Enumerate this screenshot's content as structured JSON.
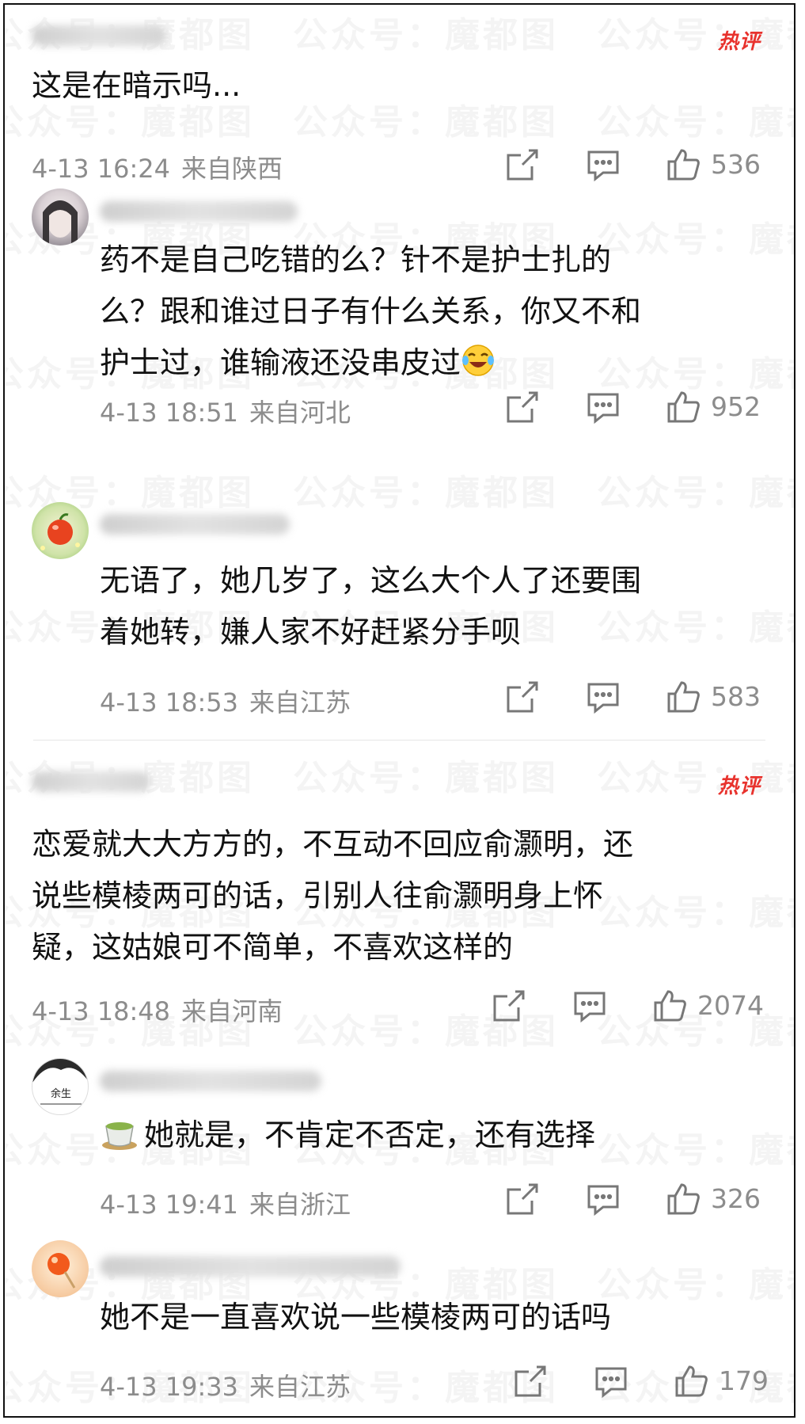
{
  "watermark_text": "公众号：魔都图",
  "hot_label": "热评",
  "comments": [
    {
      "text": "这是在暗示吗...",
      "time": "4-13 16:24",
      "location": "来自陕西",
      "likes": "536"
    },
    {
      "text_lines": [
        "药不是自己吃错的么？针不是护士扎的",
        "么？跟和谁过日子有什么关系，你又不和",
        "护士过，谁输液还没串皮过"
      ],
      "time": "4-13 18:51",
      "location": "来自河北",
      "likes": "952"
    },
    {
      "text_lines": [
        "无语了，她几岁了，这么大个人了还要围",
        "着她转，嫌人家不好赶紧分手呗"
      ],
      "time": "4-13 18:53",
      "location": "来自江苏",
      "likes": "583"
    },
    {
      "text_lines": [
        "恋爱就大大方方的，不互动不回应俞灏明，还",
        "说些模棱两可的话，引别人往俞灏明身上怀",
        "疑，这姑娘可不简单，不喜欢这样的"
      ],
      "time": "4-13 18:48",
      "location": "来自河南",
      "likes": "2074"
    },
    {
      "text": "她就是，不肯定不否定，还有选择",
      "time": "4-13 19:41",
      "location": "来自浙江",
      "likes": "326",
      "avatar_text": "余生"
    },
    {
      "text": "她不是一直喜欢说一些模棱两可的话吗",
      "time": "4-13 19:33",
      "location": "来自江苏",
      "likes": "179"
    }
  ],
  "colors": {
    "hot": "#e8322d",
    "meta": "#8c8c8c",
    "text": "#111111"
  }
}
